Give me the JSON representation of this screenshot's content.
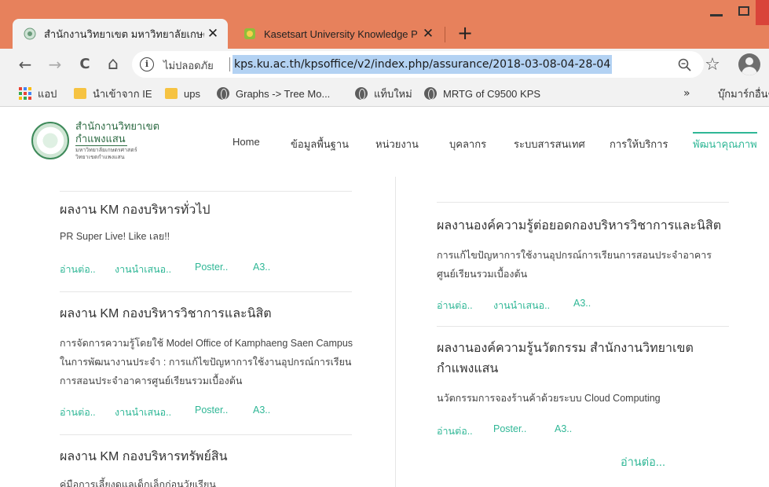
{
  "browser": {
    "tabs": [
      {
        "title": "สำนักงานวิทยาเขต มหาวิทยาลัยเกษตร",
        "active": true
      },
      {
        "title": "Kasetsart University Knowledge P",
        "active": false
      }
    ],
    "new_tab_symbol": "+",
    "close_symbol": "✕",
    "toolbar": {
      "back": "←",
      "forward": "→",
      "reload": "C",
      "home": "⌂",
      "info_symbol": "i",
      "secure_label": "ไม่ปลอดภัย",
      "url": "kps.ku.ac.th/kpsoffice/v2/index.php/assurance/2018-03-08-04-28-04",
      "star": "☆"
    },
    "bookmarks": [
      {
        "label": "แอป",
        "icon": "apps-icon"
      },
      {
        "label": "นำเข้าจาก IE",
        "icon": "folder-icon"
      },
      {
        "label": "ups",
        "icon": "folder-icon"
      },
      {
        "label": "Graphs -> Tree Mo...",
        "icon": "globe-icon"
      },
      {
        "label": "แท็บใหม่",
        "icon": "globe-icon"
      },
      {
        "label": "MRTG of C9500 KPS",
        "icon": "globe-icon"
      },
      {
        "label": "บุ๊กมาร์กอื่นๆ",
        "icon": "folder-icon"
      }
    ],
    "bookmarks_more": "»",
    "colors": {
      "titlebar": "#e7815c",
      "tab_active": "#f2f2f2",
      "url_highlight": "#b3d2f3"
    }
  },
  "site": {
    "logo": {
      "line1": "สำนักงานวิทยาเขต",
      "line2": "กำแพงแสน",
      "sub1": "มหาวิทยาลัยเกษตรศาสตร์",
      "sub2": "วิทยาเขตกำแพงแสน"
    },
    "nav": [
      {
        "label": "Home"
      },
      {
        "label": "ข้อมูลพื้นฐาน"
      },
      {
        "label": "หน่วยงาน"
      },
      {
        "label": "บุคลากร"
      },
      {
        "label": "ระบบสารสนเทศ"
      },
      {
        "label": "การให้บริการ"
      },
      {
        "label": "พัฒนาคุณภาพ",
        "active": true
      }
    ],
    "accent_color": "#2fb796"
  },
  "left_column": [
    {
      "title": "ผลงาน KM กองบริหารทั่วไป",
      "description": "PR Super Live! Like เลย!!",
      "links": [
        "อ่านต่อ..",
        "งานนำเสนอ..",
        "Poster..",
        "A3.."
      ]
    },
    {
      "title": "ผลงาน KM กองบริหารวิชาการและนิสิต",
      "description": "การจัดการความรู้โดยใช้ Model Office of Kamphaeng Saen Campus ในการพัฒนางานประจำ : การแก้ไขปัญหาการใช้งานอุปกรณ์การเรียนการสอนประจำอาคารศูนย์เรียนรวมเบื้องต้น",
      "links": [
        "อ่านต่อ..",
        "งานนำเสนอ..",
        "Poster..",
        "A3.."
      ]
    },
    {
      "title": "ผลงาน KM กองบริหารทรัพย์สิน",
      "description": "คู่มือการเลี้ยงดูแลเด็กเล็กก่อนวัยเรียน"
    }
  ],
  "right_column": [
    {
      "title": "ผลงานองค์ความรู้ต่อยอดกองบริหารวิชาการและนิสิต",
      "description": "การแก้ไขปัญหาการใช้งานอุปกรณ์การเรียนการสอนประจำอาคารศูนย์เรียนรวมเบื้องต้น",
      "links": [
        "อ่านต่อ..",
        "งานนำเสนอ..",
        "A3.."
      ]
    },
    {
      "title": "ผลงานองค์ความรู้นวัตกรรม สำนักงานวิทยาเขตกำแพงแสน",
      "description": "นวัตกรรมการจองร้านค้าด้วยระบบ Cloud Computing",
      "links": [
        "อ่านต่อ..",
        "Poster..",
        "A3.."
      ]
    }
  ],
  "read_more": "อ่านต่อ..."
}
